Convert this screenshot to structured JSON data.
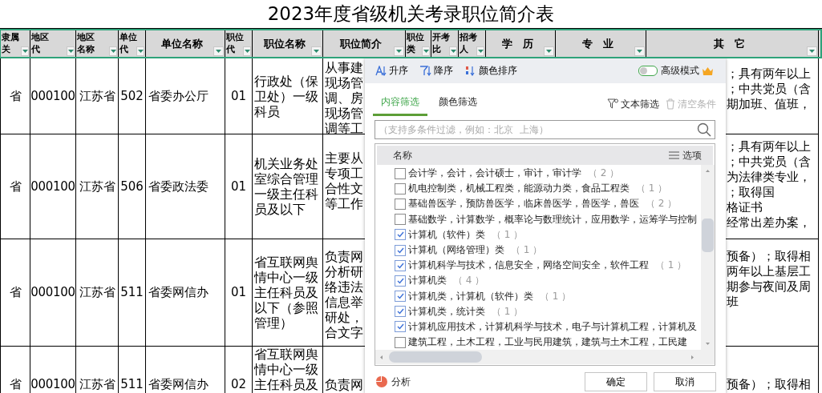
{
  "title": "2023年度省级机关考录职位简介表",
  "columns": [
    "隶属关",
    "地区代",
    "地区名称",
    "单位代",
    "单位名称",
    "职位代",
    "职位名称",
    "职位简介",
    "职位类",
    "开考比",
    "招考人",
    "学　历",
    "专　业",
    "其　它"
  ],
  "rows": [
    {
      "cells": [
        "省",
        "000100",
        "江苏省",
        "502",
        "省委办公厅",
        "01",
        "行政处（保卫处）一级科员"
      ],
      "intro": [
        "从事建",
        "现场管",
        "调、房",
        "现场管",
        "调等工"
      ],
      "other": [
        "；具有两年以上",
        "；中共党员（含",
        "期加班、值班，"
      ]
    },
    {
      "cells": [
        "省",
        "000100",
        "江苏省",
        "506",
        "省委政法委",
        "01",
        "机关业务处室综合管理一级主任科员及以下"
      ],
      "intro": [
        "主要从",
        "专项工",
        "合性文",
        "等工作"
      ],
      "other": [
        "；具有两年以上",
        "；中共党员（含",
        "为法律类专业，",
        "；取得国",
        "格证书",
        "经常出差办案，"
      ]
    },
    {
      "cells": [
        "省",
        "000100",
        "江苏省",
        "511",
        "省委网信办",
        "01",
        "省互联网舆情中心一级主任科员及以下（参照管理）"
      ],
      "intro": [
        "负责网",
        "分析研",
        "络违法",
        "信息举",
        "研处，",
        "合文字"
      ],
      "other": [
        "预备）；取得相",
        "两年以上基层工",
        "期参与夜间及周",
        "班"
      ]
    },
    {
      "cells": [
        "省",
        "000100",
        "江苏省",
        "511",
        "省委网信办",
        "02",
        "省互联网舆情中心一级主任科员及"
      ],
      "intro": [
        "负责网"
      ],
      "other": [
        "预备）；取得相"
      ]
    }
  ],
  "filter_panel": {
    "sort_buttons": [
      {
        "label": "升序",
        "kind": "ascending"
      },
      {
        "label": "降序",
        "kind": "descending"
      },
      {
        "label": "颜色排序",
        "kind": "color"
      }
    ],
    "advanced_mode": {
      "label": "高级模式",
      "on": false
    },
    "tabs": [
      {
        "label": "内容筛选",
        "selected": true
      },
      {
        "label": "颜色筛选",
        "selected": false
      }
    ],
    "text_filter": "文本筛选",
    "clear": {
      "label": "清空条件",
      "disabled": true
    },
    "search": {
      "placeholder": "（支持多条件过滤，例如：北京  上海）"
    },
    "list_header": "名称",
    "options": "选项",
    "items": [
      {
        "label": "会计学，会计，会计硕士，审计，审计学",
        "count": "（ 2 ）",
        "checked": false
      },
      {
        "label": "机电控制类，机械工程类，能源动力类，食品工程类",
        "count": "（ 1 ）",
        "checked": false
      },
      {
        "label": "基础兽医学，预防兽医学，临床兽医学，兽医学，兽医",
        "count": "（ 2 ）",
        "checked": false
      },
      {
        "label": "基础数学，计算数学，概率论与数理统计，应用数学，运筹学与控制",
        "checked": false
      },
      {
        "label": "计算机（软件）类",
        "count": "（ 1 ）",
        "checked": true
      },
      {
        "label": "计算机（网络管理）类",
        "count": "（ 1 ）",
        "checked": true
      },
      {
        "label": "计算机科学与技术，信息安全，网络空间安全，软件工程",
        "count": "（ 1 ）",
        "checked": true
      },
      {
        "label": "计算机类",
        "count": "（ 4 ）",
        "checked": true
      },
      {
        "label": "计算机类，计算机（软件）类",
        "count": "（ 1 ）",
        "checked": true
      },
      {
        "label": "计算机类，统计类",
        "count": "（ 1 ）",
        "checked": true
      },
      {
        "label": "计算机应用技术，计算机科学与技术，电子与计算机工程，计算机及",
        "checked": true
      },
      {
        "label": "建筑工程，土木工程，工业与民用建筑，建筑与土木工程，工民建",
        "checked": false
      }
    ],
    "analyze": "分析",
    "buttons": [
      "确定",
      "取消"
    ]
  }
}
